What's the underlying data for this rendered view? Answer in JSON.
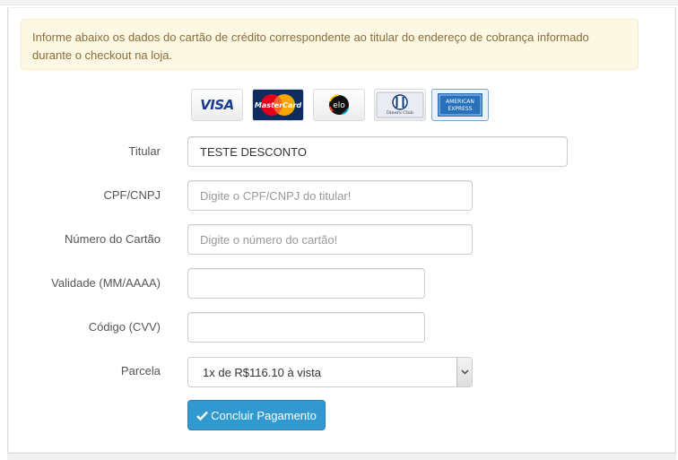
{
  "notice": {
    "text": "Informe abaixo os dados do cartão de crédito correspondente ao titular do endereço de cobrança informado durante o checkout na loja."
  },
  "card_brands": [
    {
      "name": "Visa",
      "label": "VISA"
    },
    {
      "name": "MasterCard",
      "label": "MasterCard"
    },
    {
      "name": "Elo",
      "label": "elo"
    },
    {
      "name": "Diners Club",
      "label": "Diners Club"
    },
    {
      "name": "American Express",
      "label": "AMERICAN EXPRESS"
    }
  ],
  "selected_brand": "American Express",
  "form": {
    "holder": {
      "label": "Titular",
      "value": "TESTE DESCONTO"
    },
    "document": {
      "label": "CPF/CNPJ",
      "value": "",
      "placeholder": "Digite o CPF/CNPJ do titular!"
    },
    "card_number": {
      "label": "Número do Cartão",
      "value": "",
      "placeholder": "Digite o número do cartão!"
    },
    "expiry": {
      "label": "Validade (MM/AAAA)",
      "value": ""
    },
    "cvv": {
      "label": "Código (CVV)",
      "value": ""
    },
    "installments": {
      "label": "Parcela",
      "selected": "1x de R$116.10 à vista"
    }
  },
  "submit": {
    "label": "Concluir Pagamento",
    "icon": "check-icon"
  },
  "colors": {
    "notice_bg": "#fcf8e3",
    "notice_text": "#8a6d3b",
    "button_bg": "#3199d0"
  }
}
